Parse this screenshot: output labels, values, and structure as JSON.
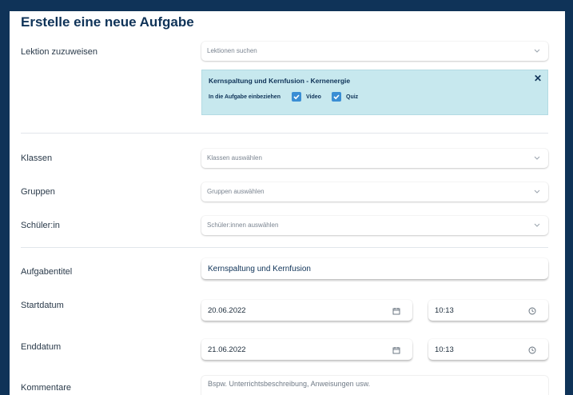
{
  "form": {
    "title": "Erstelle eine neue Aufgabe",
    "lesson_label": "Lektion zuzuweisen",
    "lesson_search_placeholder": "Lektionen suchen",
    "selected_lesson": {
      "title": "Kernspaltung und Kernfusion - Kernenergie",
      "include_label": "In die Aufgabe einbeziehen",
      "options": [
        {
          "label": "Video",
          "checked": true
        },
        {
          "label": "Quiz",
          "checked": true
        }
      ],
      "close_symbol": "✕"
    },
    "classes_label": "Klassen",
    "classes_placeholder": "Klassen auswählen",
    "groups_label": "Gruppen",
    "groups_placeholder": "Gruppen auswählen",
    "students_label": "Schüler:in",
    "students_placeholder": "Schüler:innen auswählen",
    "task_title_label": "Aufgabentitel",
    "task_title_value": "Kernspaltung und Kernfusion",
    "start_label": "Startdatum",
    "start_date": "20.06.2022",
    "start_time": "10:13",
    "end_label": "Enddatum",
    "end_date": "21.06.2022",
    "end_time": "10:13",
    "comments_label": "Kommentare",
    "comments_placeholder": "Bspw. Unterrichtsbeschreibung, Anweisungen usw."
  },
  "colors": {
    "background": "#0f3358",
    "accent": "#3a8ed4",
    "lesson_box": "#c7e8ee"
  }
}
